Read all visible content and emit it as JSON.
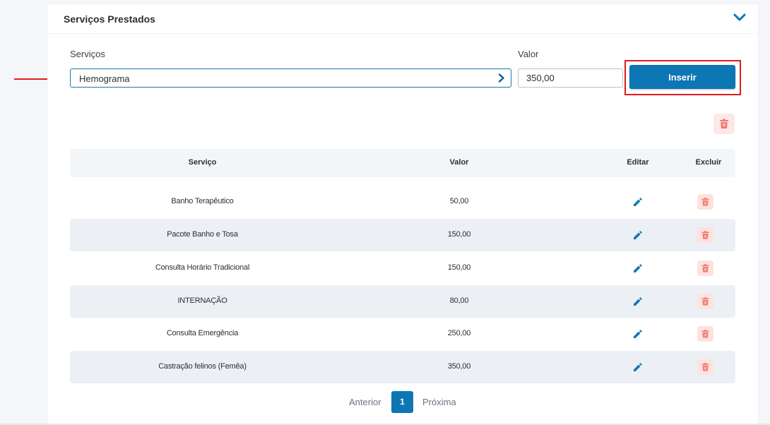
{
  "section": {
    "title": "Serviços Prestados"
  },
  "form": {
    "servicos_label": "Serviços",
    "servicos_value": "Hemograma",
    "valor_label": "Valor",
    "valor_value": "350,00",
    "insert_label": "Inserir"
  },
  "table": {
    "headers": {
      "servico": "Serviço",
      "valor": "Valor",
      "editar": "Editar",
      "excluir": "Excluir"
    },
    "rows": [
      {
        "servico": "Banho Terapêutico",
        "valor": "50,00"
      },
      {
        "servico": "Pacote Banho e Tosa",
        "valor": "150,00"
      },
      {
        "servico": "Consulta Horário Tradicional",
        "valor": "150,00"
      },
      {
        "servico": "INTERNAÇÃO",
        "valor": "80,00"
      },
      {
        "servico": "Consulta Emergência",
        "valor": "250,00"
      },
      {
        "servico": "Castração felinos (Femêa)",
        "valor": "350,00"
      }
    ]
  },
  "pagination": {
    "prev_label": "Anterior",
    "current_page": "1",
    "next_label": "Próxima"
  },
  "colors": {
    "primary": "#0d76b5",
    "highlight": "#e01b1b",
    "delete_bg": "#fde2df",
    "delete_icon": "#f07b6e",
    "row_alt": "#eceff3"
  },
  "icons": {
    "collapse": "chevron-down-icon",
    "select_open": "chevron-right-icon",
    "edit": "pencil-icon",
    "delete": "trash-icon",
    "annotation": "arrow-right-icon"
  }
}
